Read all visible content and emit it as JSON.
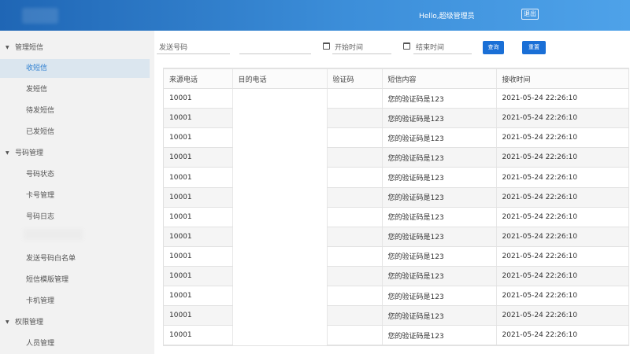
{
  "header": {
    "greeting": "Hello,超级管理员",
    "logout_label": "退出"
  },
  "sidebar": {
    "groups": [
      {
        "label": "管理短信",
        "items": [
          "收短信",
          "发短信",
          "待发短信",
          "已发短信"
        ]
      },
      {
        "label": "号码管理",
        "items": [
          "号码状态",
          "卡号管理",
          "号码日志",
          "发送号码白名单",
          "短信模版管理",
          "卡机管理"
        ]
      },
      {
        "label": "权限管理",
        "items": [
          "人员管理"
        ]
      }
    ],
    "active_item": "收短信"
  },
  "filters": {
    "sender_placeholder": "发送号码",
    "start_placeholder": "开始时间",
    "end_placeholder": "结束时间",
    "query_label": "查询",
    "reset_label": "重置"
  },
  "table": {
    "headers": [
      "来源电话",
      "目的电话",
      "验证码",
      "短信内容",
      "接收时间"
    ],
    "rows": [
      [
        "10001",
        "",
        "",
        "您的验证码是123",
        "2021-05-24 22:26:10"
      ],
      [
        "10001",
        "",
        "",
        "您的验证码是123",
        "2021-05-24 22:26:10"
      ],
      [
        "10001",
        "",
        "",
        "您的验证码是123",
        "2021-05-24 22:26:10"
      ],
      [
        "10001",
        "",
        "",
        "您的验证码是123",
        "2021-05-24 22:26:10"
      ],
      [
        "10001",
        "",
        "",
        "您的验证码是123",
        "2021-05-24 22:26:10"
      ],
      [
        "10001",
        "",
        "",
        "您的验证码是123",
        "2021-05-24 22:26:10"
      ],
      [
        "10001",
        "",
        "",
        "您的验证码是123",
        "2021-05-24 22:26:10"
      ],
      [
        "10001",
        "",
        "",
        "您的验证码是123",
        "2021-05-24 22:26:10"
      ],
      [
        "10001",
        "",
        "",
        "您的验证码是123",
        "2021-05-24 22:26:10"
      ],
      [
        "10001",
        "",
        "",
        "您的验证码是123",
        "2021-05-24 22:26:10"
      ],
      [
        "10001",
        "",
        "",
        "您的验证码是123",
        "2021-05-24 22:26:10"
      ],
      [
        "10001",
        "",
        "",
        "您的验证码是123",
        "2021-05-24 22:26:10"
      ],
      [
        "10001",
        "",
        "",
        "您的验证码是123",
        "2021-05-24 22:26:10"
      ]
    ]
  },
  "colors": {
    "header_start": "#1f66b5",
    "header_end": "#4ea2e9",
    "accent": "#1a6fd6",
    "active_text": "#2d7fd0"
  }
}
